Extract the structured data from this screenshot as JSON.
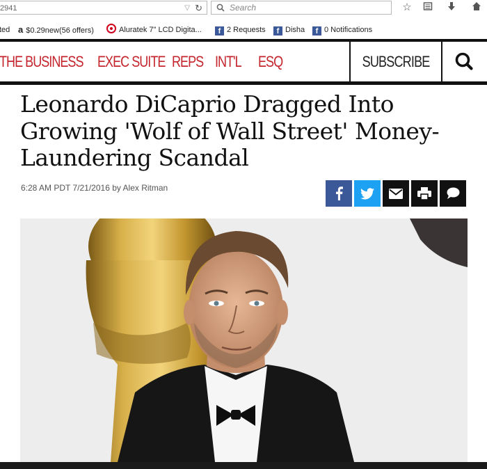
{
  "browser": {
    "url_fragment": "2941",
    "search_placeholder": "Search",
    "bookmarks": [
      {
        "label": "ted"
      },
      {
        "label": "$0.29new(56 offers)",
        "icon": "amazon-icon"
      },
      {
        "label": "Aluratek 7\" LCD Digita...",
        "icon": "target-icon"
      },
      {
        "label": "2 Requests",
        "icon": "facebook-icon"
      },
      {
        "label": "Disha",
        "icon": "facebook-icon"
      },
      {
        "label": "0 Notifications",
        "icon": "facebook-icon"
      }
    ]
  },
  "nav": {
    "items": [
      "THE BUSINESS",
      "EXEC SUITE",
      "REPS",
      "INT'L",
      "ESQ"
    ],
    "subscribe": "SUBSCRIBE",
    "accent": "#c5252d"
  },
  "article": {
    "headline": "Leonardo DiCaprio Dragged Into Growing 'Wolf of Wall Street' Money-Laundering Scandal",
    "byline": "6:28 AM PDT 7/21/2016 by Alex Ritman"
  },
  "share": {
    "buttons": [
      "facebook-icon",
      "twitter-icon",
      "email-icon",
      "print-icon",
      "comment-icon"
    ],
    "colors": {
      "facebook": "#3b5998",
      "twitter": "#1da1f2",
      "dark": "#111111"
    }
  }
}
